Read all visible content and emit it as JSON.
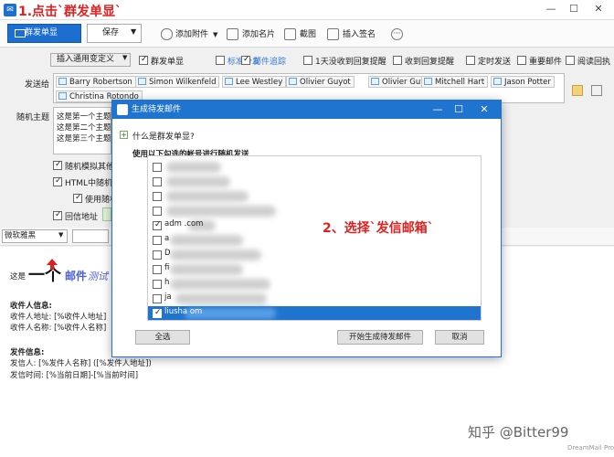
{
  "annotations": {
    "step1": "1.点击`群发单显`",
    "step2": "2、选择`发信邮箱`",
    "watermark": "知乎 @Bitter99",
    "dreammail": "DreamMail Pro"
  },
  "toolbar": {
    "send_label": "群发单显",
    "save_label": "保存",
    "attach_label": "添加附件",
    "card_label": "添加名片",
    "screenshot_label": "截图",
    "signature_label": "插入签名",
    "more_label": "···"
  },
  "options": {
    "insert_std": "插入通用变定义",
    "items": [
      {
        "label": "群发单显",
        "checked": true,
        "blue": false
      },
      {
        "label": "标准分发",
        "checked": false,
        "blue": true
      },
      {
        "label": "邮件追踪",
        "checked": true,
        "blue": true
      },
      {
        "label": "1天没收到回复提醒",
        "checked": false,
        "blue": false
      },
      {
        "label": "收到回复提醒",
        "checked": false,
        "blue": false
      },
      {
        "label": "定时发送",
        "checked": false,
        "blue": false
      },
      {
        "label": "重要邮件",
        "checked": false,
        "blue": false
      },
      {
        "label": "阅读回执",
        "checked": false,
        "blue": false
      }
    ]
  },
  "recipients": {
    "label": "发送给",
    "chips": [
      "Barry Robertson",
      "Simon Wilkenfeld",
      "Lee Westley",
      "Olivier Guyot",
      "Olivier Guyot",
      "Mitchell Hart",
      "Jason Potter",
      "Christina Rotondo"
    ]
  },
  "subject": {
    "label": "随机主题",
    "lines": [
      "这是第一个主题",
      "这是第二个主题",
      "这是第三个主题"
    ]
  },
  "side_options": {
    "random_other": "随机模拟其他",
    "html_random": "HTML中随机",
    "use_random": "使用随机",
    "reply_addr": "回信地址"
  },
  "editor": {
    "font": "微软雅黑",
    "intro_prefix": "这是",
    "intro_big": "一个",
    "intro_mail": "邮件",
    "intro_test": "测试",
    "recipient_header": "收件人信息:",
    "recipient_addr": "收件人地址: [%收件人地址]",
    "recipient_name": "收件人名称: [%收件人名称]",
    "sender_header": "发件信息:",
    "sender_line": "发信人: [%发件人名称] ([%发件人地址])",
    "send_time": "发信时间: [%当前日期]-[%当前时间]"
  },
  "dialog": {
    "title": "生成待发邮件",
    "what_is": "什么是群发单显?",
    "instruction": "使用以下勾选的帐号进行随机发送",
    "accounts": [
      {
        "label": "",
        "checked": false,
        "selected": false
      },
      {
        "label": "",
        "checked": false,
        "selected": false
      },
      {
        "label": "",
        "checked": false,
        "selected": false
      },
      {
        "label": "",
        "checked": false,
        "selected": false
      },
      {
        "label": "adm         .com",
        "checked": true,
        "selected": false
      },
      {
        "label": "a",
        "checked": false,
        "selected": false
      },
      {
        "label": "D",
        "checked": false,
        "selected": false
      },
      {
        "label": "fi",
        "checked": false,
        "selected": false
      },
      {
        "label": "h",
        "checked": false,
        "selected": false
      },
      {
        "label": "ja",
        "checked": false,
        "selected": false
      },
      {
        "label": "liusha                    om",
        "checked": true,
        "selected": true
      }
    ],
    "select_all": "全选",
    "generate": "开始生成待发邮件",
    "cancel": "取消"
  }
}
